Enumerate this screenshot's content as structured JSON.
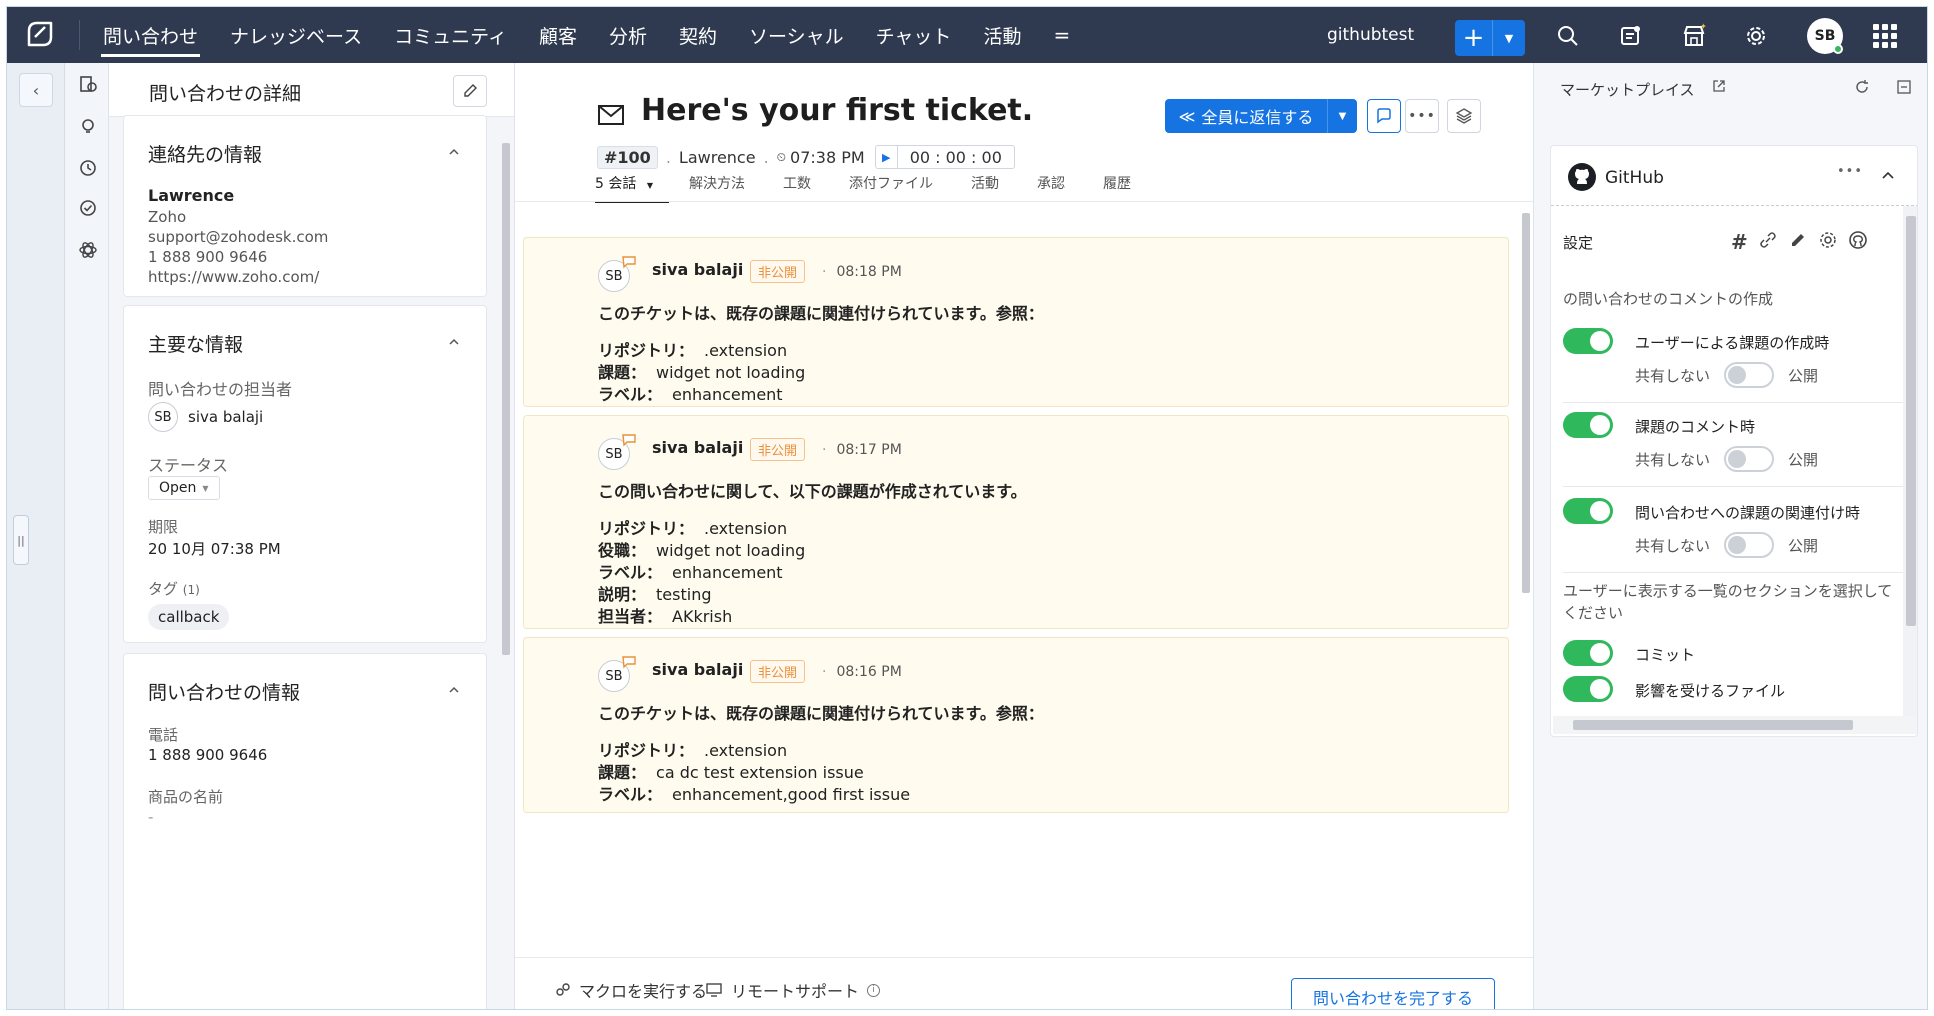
{
  "topnav": {
    "tabs": [
      "問い合わせ",
      "ナレッジベース",
      "コミュニティ",
      "顧客",
      "分析",
      "契約",
      "ソーシャル",
      "チャット",
      "活動"
    ],
    "more": "=",
    "portal": "githubtest",
    "plus": "+",
    "avatar": "SB"
  },
  "details": {
    "title": "問い合わせの詳細",
    "contact": {
      "heading": "連絡先の情報",
      "name": "Lawrence",
      "company": "Zoho",
      "email": "support@zohodesk.com",
      "phone": "1 888 900 9646",
      "website": "https://www.zoho.com/"
    },
    "key": {
      "heading": "主要な情報",
      "owner_label": "問い合わせの担当者",
      "owner_initials": "SB",
      "owner_name": "siva balaji",
      "status_label": "ステータス",
      "status_value": "Open",
      "due_label": "期限",
      "due_value": "20 10月 07:38 PM",
      "tags_label": "タグ",
      "tags_count": "(1)",
      "tag": "callback"
    },
    "ticket": {
      "heading": "問い合わせの情報",
      "phone_label": "電話",
      "phone_value": "1 888 900 9646",
      "product_label": "商品の名前",
      "product_value": "-"
    }
  },
  "ticket": {
    "subject": "Here's your first ticket.",
    "id": "#100",
    "contact": "Lawrence",
    "created": "07:38 PM",
    "timer": "00 : 00 : 00",
    "reply_all": "全員に返信する",
    "tabs": [
      "5 会話",
      "解決方法",
      "工数",
      "添付ファイル",
      "活動",
      "承認",
      "履歴"
    ],
    "conversations": [
      {
        "initials": "SB",
        "author": "siva balaji",
        "private": "非公開",
        "time": "08:18 PM",
        "heading": "このチケットは、既存の課題に関連付けられています。参照：",
        "lines": [
          {
            "k": "リポジトリ：",
            "v": ".extension"
          },
          {
            "k": "課題：",
            "v": "widget not loading"
          },
          {
            "k": "ラベル：",
            "v": "enhancement"
          }
        ]
      },
      {
        "initials": "SB",
        "author": "siva balaji",
        "private": "非公開",
        "time": "08:17 PM",
        "heading": "この問い合わせに関して、以下の課題が作成されています。",
        "lines": [
          {
            "k": "リポジトリ：",
            "v": ".extension"
          },
          {
            "k": "役職：",
            "v": "widget not loading"
          },
          {
            "k": "ラベル：",
            "v": "enhancement"
          },
          {
            "k": "説明：",
            "v": "testing"
          },
          {
            "k": "担当者：",
            "v": "AKkrish"
          }
        ]
      },
      {
        "initials": "SB",
        "author": "siva balaji",
        "private": "非公開",
        "time": "08:16 PM",
        "heading": "このチケットは、既存の課題に関連付けられています。参照：",
        "lines": [
          {
            "k": "リポジトリ：",
            "v": ".extension"
          },
          {
            "k": "課題：",
            "v": "ca dc test extension issue"
          },
          {
            "k": "ラベル：",
            "v": "enhancement,good first issue"
          }
        ]
      }
    ],
    "footer": {
      "macro": "マクロを実行する",
      "remote": "リモートサポート",
      "close": "問い合わせを完了する"
    }
  },
  "marketplace": {
    "title": "マーケットプレイス",
    "app": "GitHub",
    "settings": "設定",
    "section1": "の問い合わせのコメントの作成",
    "toggles": [
      {
        "label": "ユーザーによる課題の作成時",
        "off": "共有しない",
        "on": "公開"
      },
      {
        "label": "課題のコメント時",
        "off": "共有しない",
        "on": "公開"
      },
      {
        "label": "問い合わせへの課題の関連付け時",
        "off": "共有しない",
        "on": "公開"
      }
    ],
    "section2": "ユーザーに表示する一覧のセクションを選択してください",
    "commit": "コミット",
    "affected": "影響を受けるファイル"
  },
  "colors": {
    "nav": "#2f3a51",
    "accent": "#1674e2",
    "toggle_on": "#2fb85c",
    "private": "#e8913b"
  }
}
